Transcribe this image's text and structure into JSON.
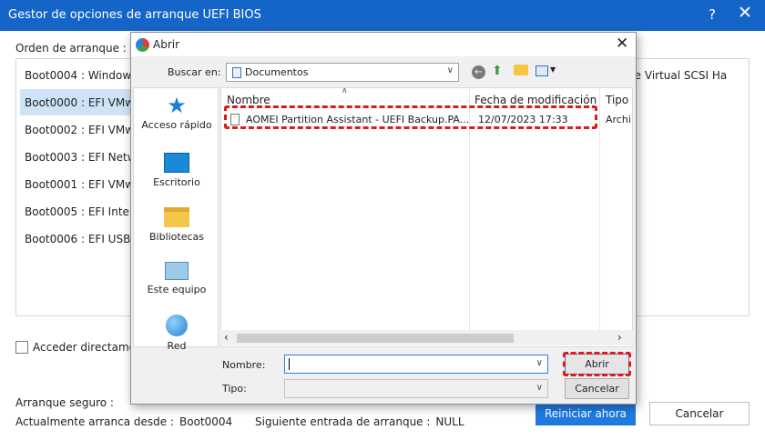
{
  "main": {
    "title": "Gestor de opciones de arranque UEFI BIOS",
    "help_icon": "?",
    "close_icon": "✕",
    "order_label": "Orden de arranque :",
    "boot_entries": [
      "Boot0004 : Windows",
      "Boot0000 : EFI VMw",
      "Boot0002 : EFI VMw",
      "Boot0003 : EFI Netw",
      "Boot0001 : EFI VMwa",
      "Boot0005 : EFI Inter",
      "Boot0006 : EFI USB"
    ],
    "selected_index": 1,
    "boot_entry_tail": "re Virtual SCSI Ha",
    "direct_access_label": "Acceder directame",
    "secure_boot_label": "Arranque seguro :",
    "current_boot_label": "Actualmente arranca desde :",
    "current_boot_value": "Boot0004",
    "next_boot_label": "Siguiente entrada de arranque :",
    "next_boot_value": "NULL",
    "restart_button": "Reiniciar ahora",
    "cancel_button": "Cancelar"
  },
  "dialog": {
    "title": "Abrir",
    "close_icon": "✕",
    "lookin_label": "Buscar en:",
    "lookin_value": "Documentos",
    "places": [
      "Acceso rápido",
      "Escritorio",
      "Bibliotecas",
      "Este equipo",
      "Red"
    ],
    "columns": {
      "name": "Nombre",
      "date": "Fecha de modificación",
      "type": "Tipo"
    },
    "file": {
      "name": "AOMEI Partition Assistant - UEFI Backup.PA...",
      "date": "12/07/2023 17:33",
      "type": "Archi"
    },
    "name_label": "Nombre:",
    "name_value": "",
    "type_label": "Tipo:",
    "type_value": "",
    "open_button": "Abrir",
    "cancel_button": "Cancelar"
  },
  "colors": {
    "title_bar": "#1565c8",
    "primary_button": "#1f7ae0",
    "highlight_box": "#e01919",
    "selection": "#cfe3f6"
  }
}
